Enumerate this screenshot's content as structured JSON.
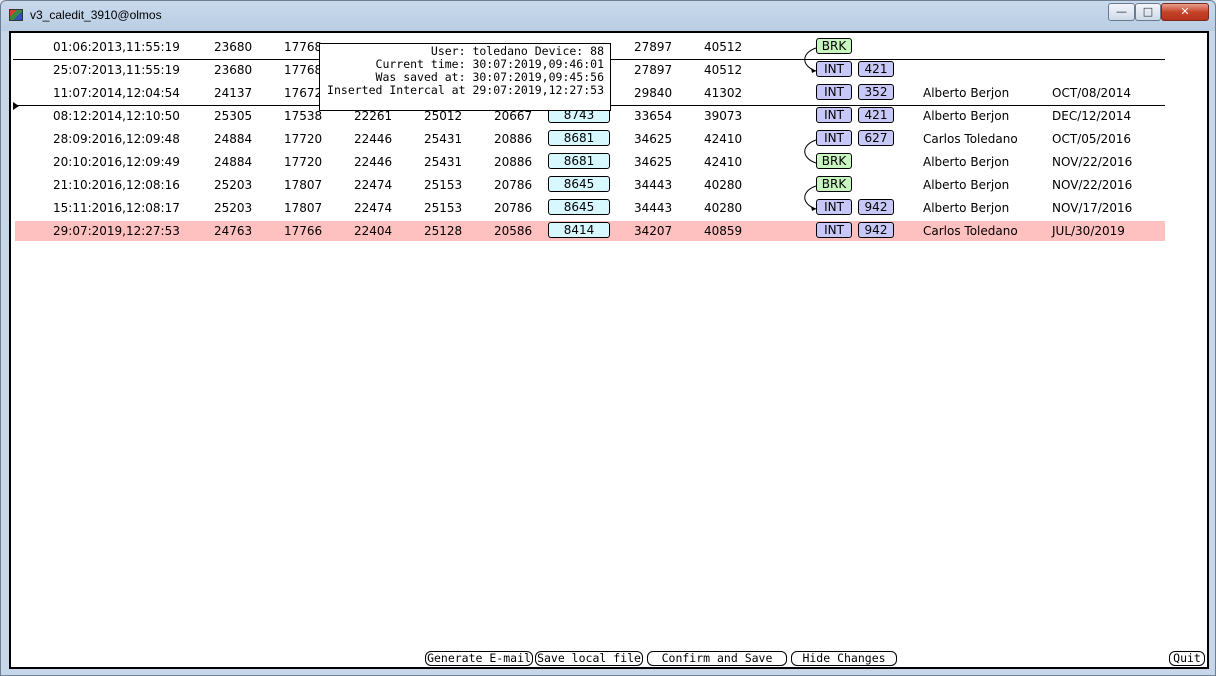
{
  "window": {
    "title": "v3_caledit_3910@olmos"
  },
  "tooltip": {
    "line1": "User: toledano Device: 88",
    "line2": "Current time: 30:07:2019,09:46:01",
    "line3": "Was saved at: 30:07:2019,09:45:56",
    "line4": "Inserted Intercal at 29:07:2019,12:27:53"
  },
  "rows": [
    {
      "ts": "01:06:2013,11:55:19",
      "c1": "23680",
      "c2": "17768",
      "c3": "",
      "c4": "",
      "c5": "",
      "c6": "",
      "c7": "27897",
      "c8": "40512",
      "type": "BRK",
      "num": "",
      "user": "",
      "date": ""
    },
    {
      "ts": "25:07:2013,11:55:19",
      "c1": "23680",
      "c2": "17768",
      "c3": "",
      "c4": "",
      "c5": "",
      "c6": "",
      "c7": "27897",
      "c8": "40512",
      "type": "INT",
      "num": "421",
      "user": "",
      "date": ""
    },
    {
      "ts": "11:07:2014,12:04:54",
      "c1": "24137",
      "c2": "17672",
      "c3": "",
      "c4": "",
      "c5": "",
      "c6": "",
      "c7": "29840",
      "c8": "41302",
      "type": "INT",
      "num": "352",
      "user": "Alberto Berjon",
      "date": "OCT/08/2014"
    },
    {
      "ts": "08:12:2014,12:10:50",
      "c1": "25305",
      "c2": "17538",
      "c3": "22261",
      "c4": "25012",
      "c5": "20667",
      "c6": "8743",
      "c7": "33654",
      "c8": "39073",
      "type": "INT",
      "num": "421",
      "user": "Alberto Berjon",
      "date": "DEC/12/2014"
    },
    {
      "ts": "28:09:2016,12:09:48",
      "c1": "24884",
      "c2": "17720",
      "c3": "22446",
      "c4": "25431",
      "c5": "20886",
      "c6": "8681",
      "c7": "34625",
      "c8": "42410",
      "type": "INT",
      "num": "627",
      "user": "Carlos Toledano",
      "date": "OCT/05/2016"
    },
    {
      "ts": "20:10:2016,12:09:49",
      "c1": "24884",
      "c2": "17720",
      "c3": "22446",
      "c4": "25431",
      "c5": "20886",
      "c6": "8681",
      "c7": "34625",
      "c8": "42410",
      "type": "BRK",
      "num": "",
      "user": "Alberto Berjon",
      "date": "NOV/22/2016"
    },
    {
      "ts": "21:10:2016,12:08:16",
      "c1": "25203",
      "c2": "17807",
      "c3": "22474",
      "c4": "25153",
      "c5": "20786",
      "c6": "8645",
      "c7": "34443",
      "c8": "40280",
      "type": "BRK",
      "num": "",
      "user": "Alberto Berjon",
      "date": "NOV/22/2016"
    },
    {
      "ts": "15:11:2016,12:08:17",
      "c1": "25203",
      "c2": "17807",
      "c3": "22474",
      "c4": "25153",
      "c5": "20786",
      "c6": "8645",
      "c7": "34443",
      "c8": "40280",
      "type": "INT",
      "num": "942",
      "user": "Alberto Berjon",
      "date": "NOV/17/2016"
    },
    {
      "ts": "29:07:2019,12:27:53",
      "c1": "24763",
      "c2": "17766",
      "c3": "22404",
      "c4": "25128",
      "c5": "20586",
      "c6": "8414",
      "c7": "34207",
      "c8": "40859",
      "type": "INT",
      "num": "942",
      "user": "Carlos Toledano",
      "date": "JUL/30/2019",
      "highlight": true
    }
  ],
  "buttons": {
    "generate_email": "Generate E-mail",
    "save_local": "Save local file",
    "confirm_save": "Confirm and Save",
    "hide_changes": "Hide Changes",
    "quit": "Quit"
  },
  "colors": {
    "brk_tag": "#c8f5c0",
    "int_tag": "#c8c8f8",
    "value_box": "#d8f8ff",
    "highlight_row": "#ffc0c0"
  }
}
